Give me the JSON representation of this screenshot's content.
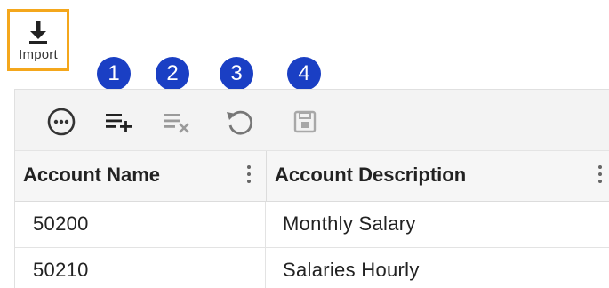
{
  "import_button": {
    "label": "Import",
    "icon": "download-icon",
    "border_color": "#f4a71c"
  },
  "badges": [
    "1",
    "2",
    "3",
    "4"
  ],
  "badge_color": "#1a3fc4",
  "toolbar": {
    "icons": [
      "more-options-icon",
      "add-row-icon",
      "delete-row-icon",
      "undo-icon",
      "save-icon"
    ]
  },
  "columns": [
    {
      "label": "Account Name"
    },
    {
      "label": "Account Description"
    }
  ],
  "rows": [
    {
      "account_name": "50200",
      "account_description": "Monthly Salary"
    },
    {
      "account_name": "50210",
      "account_description": "Salaries Hourly"
    }
  ]
}
